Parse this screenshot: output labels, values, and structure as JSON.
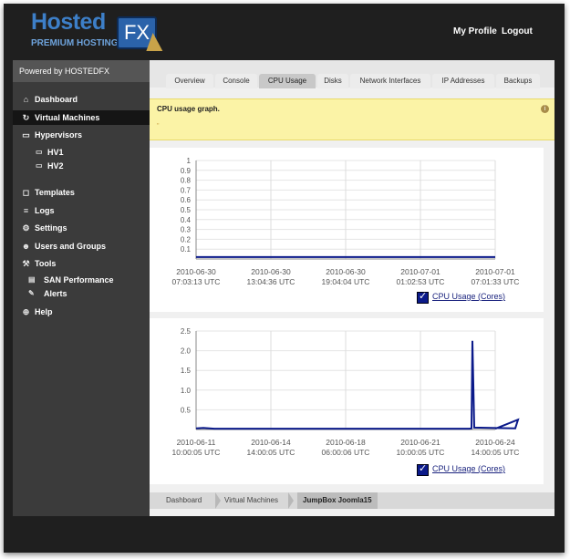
{
  "header": {
    "logo_main": "Hosted",
    "logo_sub": "PREMIUM HOSTING",
    "logo_badge": "FX",
    "links": {
      "profile": "My Profile",
      "logout": "Logout"
    }
  },
  "sidebar": {
    "powered_by": "Powered by  HOSTEDFX",
    "items": [
      {
        "label": "Dashboard",
        "icon": "home-icon"
      },
      {
        "label": "Virtual Machines",
        "icon": "refresh-icon"
      },
      {
        "label": "Hypervisors",
        "icon": "monitor-icon"
      },
      {
        "label": "HV1",
        "icon": "monitor-icon"
      },
      {
        "label": "HV2",
        "icon": "monitor-icon"
      },
      {
        "label": "Templates",
        "icon": "template-icon"
      },
      {
        "label": "Logs",
        "icon": "list-icon"
      },
      {
        "label": "Settings",
        "icon": "gear-icon"
      },
      {
        "label": "Users and Groups",
        "icon": "users-icon"
      },
      {
        "label": "Tools",
        "icon": "wrench-icon"
      },
      {
        "label": "SAN Performance",
        "icon": "chart-icon"
      },
      {
        "label": "Alerts",
        "icon": "edit-icon"
      },
      {
        "label": "Help",
        "icon": "lifebuoy-icon"
      }
    ]
  },
  "tabs": [
    "Overview",
    "Console",
    "CPU Usage",
    "Disks",
    "Network Interfaces",
    "IP Addresses",
    "Backups"
  ],
  "active_tab": "CPU Usage",
  "notice": {
    "text": "CPU usage graph.",
    "mark": "\""
  },
  "chart_data": [
    {
      "type": "line",
      "series": [
        {
          "name": "CPU Usage (Cores)",
          "x": [
            "2010-06-30 07:03:13",
            "2010-06-30 13:04:36",
            "2010-06-30 19:04:04",
            "2010-07-01 01:02:53",
            "2010-07-01 07:01:33"
          ],
          "values": [
            0.02,
            0.02,
            0.02,
            0.02,
            0.02
          ]
        }
      ],
      "ylim": [
        0,
        1
      ],
      "yticks": [
        "1",
        "0.9",
        "0.8",
        "0.7",
        "0.6",
        "0.5",
        "0.4",
        "0.3",
        "0.2",
        "0.1"
      ],
      "xticks": [
        [
          "2010-06-30",
          "07:03:13 UTC"
        ],
        [
          "2010-06-30",
          "13:04:36 UTC"
        ],
        [
          "2010-06-30",
          "19:04:04 UTC"
        ],
        [
          "2010-07-01",
          "01:02:53 UTC"
        ],
        [
          "2010-07-01",
          "07:01:33 UTC"
        ]
      ],
      "legend": "CPU Usage (Cores)",
      "color": "#0b1a8a",
      "grid": true
    },
    {
      "type": "line",
      "series": [
        {
          "name": "CPU Usage (Cores)",
          "x": [
            0,
            1,
            2,
            3,
            4,
            5,
            6,
            7,
            8,
            9,
            10,
            11,
            12,
            13,
            14
          ],
          "values": [
            0.03,
            0.04,
            0.02,
            0.02,
            0.02,
            0.02,
            0.02,
            0.02,
            0.02,
            0.02,
            0.03,
            2.25,
            0.05,
            0.03,
            0.25
          ]
        }
      ],
      "ylim": [
        0,
        2.5
      ],
      "yticks": [
        "2.5",
        "2.0",
        "1.5",
        "1.0",
        "0.5"
      ],
      "xticks": [
        [
          "2010-06-11",
          "10:00:05 UTC"
        ],
        [
          "2010-06-14",
          "14:00:05 UTC"
        ],
        [
          "2010-06-18",
          "06:00:06 UTC"
        ],
        [
          "2010-06-21",
          "10:00:05 UTC"
        ],
        [
          "2010-06-24",
          "14:00:05 UTC"
        ]
      ],
      "legend": "CPU Usage (Cores)",
      "color": "#0b1a8a",
      "grid": true
    }
  ],
  "breadcrumb": [
    "Dashboard",
    "Virtual Machines",
    "JumpBox Joomla15"
  ]
}
